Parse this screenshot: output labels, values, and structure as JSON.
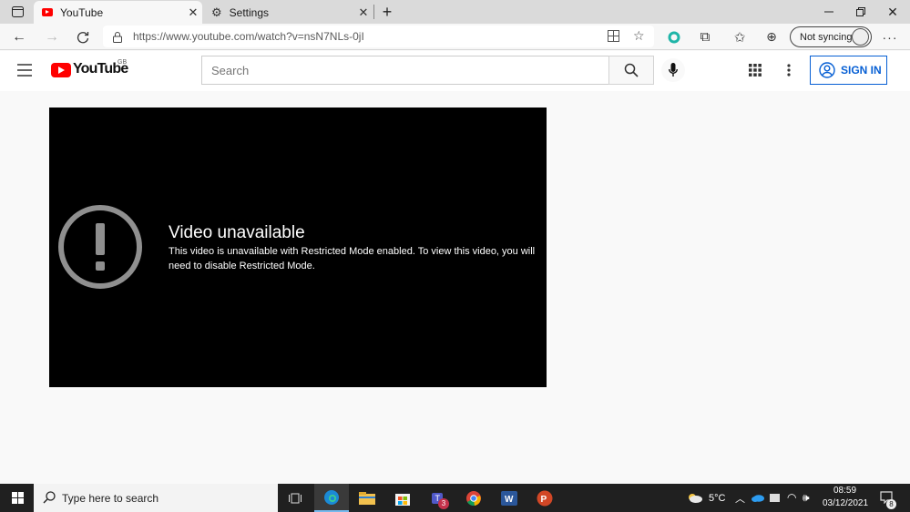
{
  "browser": {
    "tabs": [
      {
        "label": "YouTube",
        "active": true
      },
      {
        "label": "Settings",
        "active": false
      }
    ],
    "url": "https://www.youtube.com/watch?v=nsN7NLs-0jI",
    "sync_label": "Not syncing"
  },
  "youtube": {
    "logo_text": "YouTube",
    "region": "GB",
    "search_placeholder": "Search",
    "signin_label": "SIGN IN",
    "brand_color": "#ff0000",
    "link_color": "#065fd4"
  },
  "player": {
    "title": "Video unavailable",
    "message": "This video is unavailable with Restricted Mode enabled. To view this video, you will need to disable Restricted Mode."
  },
  "taskbar": {
    "search_placeholder": "Type here to search",
    "temperature": "5°C",
    "time": "08:59",
    "date": "03/12/2021",
    "notifications": "8",
    "teams_badge": "3"
  }
}
